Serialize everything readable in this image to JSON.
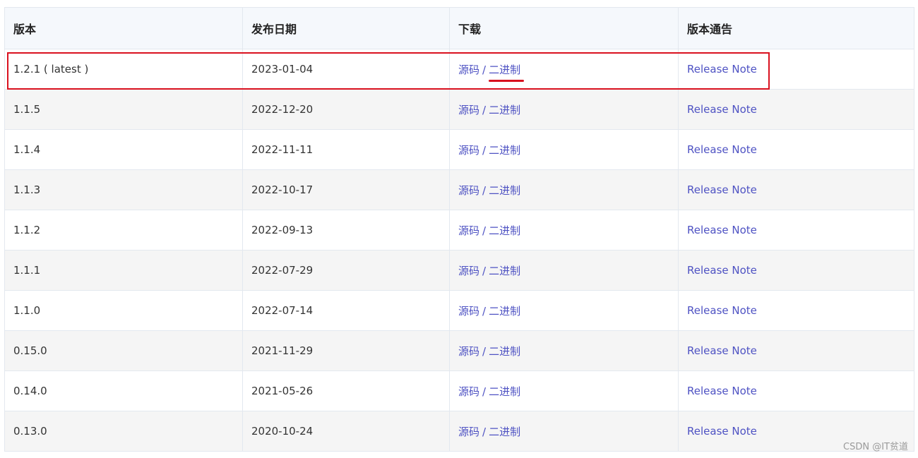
{
  "table": {
    "headers": {
      "version": "版本",
      "release_date": "发布日期",
      "download": "下载",
      "release_notes": "版本通告"
    },
    "download_separator": "/",
    "rows": [
      {
        "version": "1.2.1 ( latest )",
        "date": "2023-01-04",
        "source": "源码",
        "binary": "二进制",
        "note": "Release Note"
      },
      {
        "version": "1.1.5",
        "date": "2022-12-20",
        "source": "源码",
        "binary": "二进制",
        "note": "Release Note"
      },
      {
        "version": "1.1.4",
        "date": "2022-11-11",
        "source": "源码",
        "binary": "二进制",
        "note": "Release Note"
      },
      {
        "version": "1.1.3",
        "date": "2022-10-17",
        "source": "源码",
        "binary": "二进制",
        "note": "Release Note"
      },
      {
        "version": "1.1.2",
        "date": "2022-09-13",
        "source": "源码",
        "binary": "二进制",
        "note": "Release Note"
      },
      {
        "version": "1.1.1",
        "date": "2022-07-29",
        "source": "源码",
        "binary": "二进制",
        "note": "Release Note"
      },
      {
        "version": "1.1.0",
        "date": "2022-07-14",
        "source": "源码",
        "binary": "二进制",
        "note": "Release Note"
      },
      {
        "version": "0.15.0",
        "date": "2021-11-29",
        "source": "源码",
        "binary": "二进制",
        "note": "Release Note"
      },
      {
        "version": "0.14.0",
        "date": "2021-05-26",
        "source": "源码",
        "binary": "二进制",
        "note": "Release Note"
      },
      {
        "version": "0.13.0",
        "date": "2020-10-24",
        "source": "源码",
        "binary": "二进制",
        "note": "Release Note"
      }
    ]
  },
  "annotations": {
    "highlight_color": "#d9111f",
    "highlighted_row": "1.2.1 ( latest )",
    "underlined_link": "二进制"
  },
  "colors": {
    "link": "#4e52c3",
    "header_bg": "#f5f8fc",
    "stripe_bg": "#f5f5f5",
    "border": "#e3e8ef"
  },
  "watermark": "CSDN @IT贫道"
}
